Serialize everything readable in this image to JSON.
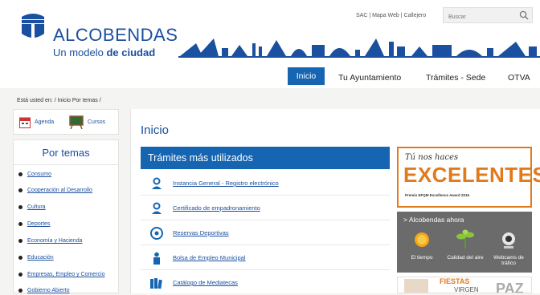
{
  "header": {
    "brand_name": "ALCOBENDAS",
    "brand_tag_pre": "Un modelo ",
    "brand_tag_bold": "de ciudad",
    "top_links": "SAC | Mapa Web | Callejero",
    "search_placeholder": "Buscar"
  },
  "nav": {
    "inicio": "Inicio",
    "ayuntamiento": "Tu Ayuntamiento",
    "tramites": "Trámites - Sede",
    "otva": "OTVA"
  },
  "breadcrumb": "Está usted en: / Inicio Por temas /",
  "quick_links": {
    "agenda": "Agenda",
    "cursos": "Cursos"
  },
  "temas": {
    "title": "Por temas",
    "items": [
      "Consumo",
      "Cooperación al Desarrollo",
      "Cultura",
      "Deportes",
      "Economía y Hacienda",
      "Educación",
      "Empresas, Empleo y Comercio",
      "Gobierno Abierto"
    ]
  },
  "main": {
    "title": "Inicio",
    "tramites_header": "Trámites más utilizados",
    "tramites": [
      {
        "label": "Instancia General - Registro electrónico",
        "icon": "person-icon"
      },
      {
        "label": "Certificado de empadronamiento",
        "icon": "person-icon"
      },
      {
        "label": "Reservas Deportivas",
        "icon": "ball-icon"
      },
      {
        "label": "Bolsa de Empleo Municipal",
        "icon": "worker-icon"
      },
      {
        "label": "Catálogo de Mediatecas",
        "icon": "books-icon"
      }
    ]
  },
  "banners": {
    "excelentes_pre": "Tú nos haces",
    "excelentes_main": "EXCELENTES",
    "excelentes_sub": "Premio EFQM Excellence Award 2016",
    "ahora_title": "> Alcobendas ahora",
    "ahora_items": [
      {
        "label": "El tiempo"
      },
      {
        "label": "Calidad del aire"
      },
      {
        "label": "Webcams de tráfico"
      }
    ],
    "fiestas": "FIESTAS",
    "virgen": "VIRGEN",
    "paz": "PAZ"
  },
  "colors": {
    "brand_blue": "#1b4fa0",
    "nav_blue": "#1565b3",
    "orange": "#e07a1c"
  }
}
